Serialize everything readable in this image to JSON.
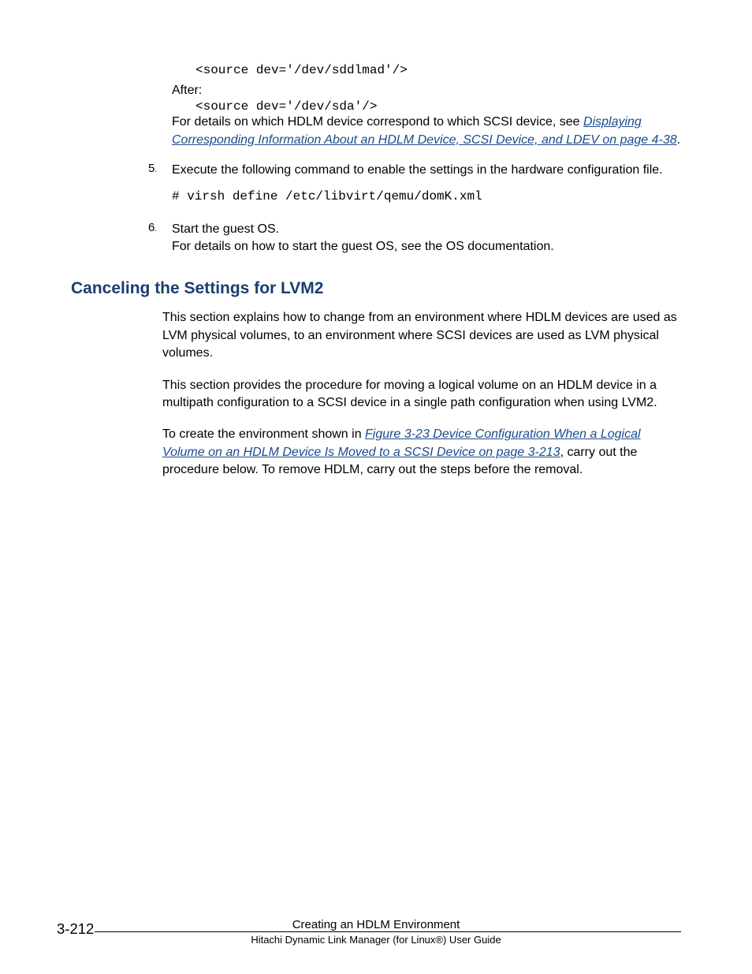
{
  "code_before": "<source dev='/dev/sddlmad'/>",
  "after_label": "After:",
  "code_after": "<source dev='/dev/sda'/>",
  "step4_tail_pre": "For details on which HDLM device correspond to which SCSI device, see ",
  "step4_link": "Displaying Corresponding Information About an HDLM Device, SCSI Device, and LDEV on page 4-38",
  "step4_tail_post": ".",
  "step5_num": "5",
  "step5_text": "Execute the following command to enable the settings in the hardware configuration file.",
  "step5_code": "# virsh define /etc/libvirt/qemu/domK.xml",
  "step6_num": "6",
  "step6_line1": "Start the guest OS.",
  "step6_line2": "For details on how to start the guest OS, see the OS documentation.",
  "heading": "Canceling the Settings for LVM2",
  "p1": "This section explains how to change from an environment where HDLM devices are used as LVM physical volumes, to an environment where SCSI devices are used as LVM physical volumes.",
  "p2": "This section provides the procedure for moving a logical volume on an HDLM device in a multipath configuration to a SCSI device in a single path configuration when using LVM2.",
  "p3_pre": "To create the environment shown in ",
  "p3_link": "Figure 3-23 Device Configuration When a Logical Volume on an HDLM Device Is Moved to a SCSI Device on page 3-213",
  "p3_post": ", carry out the procedure below. To remove HDLM, carry out the steps before the removal.",
  "footer_title": "Creating an HDLM Environment",
  "footer_sub": "Hitachi Dynamic Link Manager (for Linux®) User Guide",
  "page_number": "3-212"
}
